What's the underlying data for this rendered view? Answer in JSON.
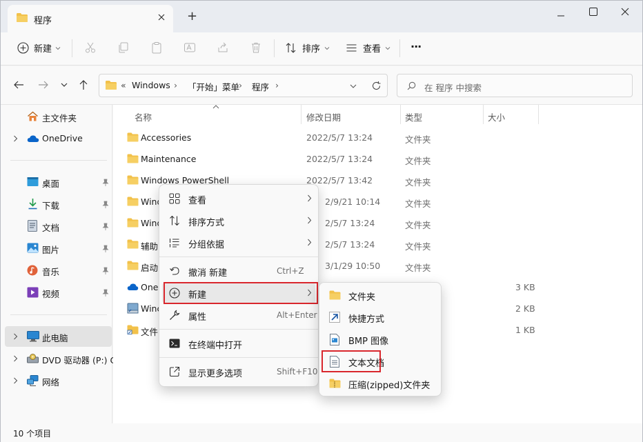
{
  "window": {
    "tab_title": "程序",
    "new_tab": "+"
  },
  "toolbar": {
    "new_label": "新建",
    "sort_label": "排序",
    "view_label": "查看",
    "more_label": "···"
  },
  "address": {
    "overflow": "«",
    "crumbs": [
      "Windows",
      "「开始」菜单",
      "程序"
    ],
    "search_placeholder": "在 程序 中搜索"
  },
  "nav": {
    "home": "主文件夹",
    "onedrive": "OneDrive",
    "desktop": "桌面",
    "downloads": "下载",
    "documents": "文档",
    "pictures": "图片",
    "music": "音乐",
    "videos": "视频",
    "this_pc": "此电脑",
    "dvd": "DVD 驱动器 (P:) C",
    "network": "网络"
  },
  "columns": {
    "name": "名称",
    "date": "修改日期",
    "type": "类型",
    "size": "大小"
  },
  "files": [
    {
      "name": "Accessories",
      "date": "2022/5/7 13:24",
      "type": "文件夹",
      "size": ""
    },
    {
      "name": "Maintenance",
      "date": "2022/5/7 13:24",
      "type": "文件夹",
      "size": ""
    },
    {
      "name": "Windows PowerShell",
      "date": "2022/5/7 13:42",
      "type": "文件夹",
      "size": ""
    },
    {
      "name": "Wind",
      "date": "2/9/21 10:14",
      "type": "文件夹",
      "size": ""
    },
    {
      "name": "Wind",
      "date": "2/5/7 13:24",
      "type": "文件夹",
      "size": ""
    },
    {
      "name": "辅助",
      "date": "2/5/7 13:24",
      "type": "文件夹",
      "size": ""
    },
    {
      "name": "启动",
      "date": "3/1/29 10:50",
      "type": "文件夹",
      "size": ""
    },
    {
      "name": "OneI",
      "date": "",
      "type": "",
      "size": "3 KB"
    },
    {
      "name": "Winc",
      "date": "",
      "type": "",
      "size": "2 KB"
    },
    {
      "name": "文件",
      "date": "",
      "type": "",
      "size": "1 KB"
    }
  ],
  "context_menu": {
    "view": "查看",
    "sort": "排序方式",
    "group": "分组依据",
    "undo": "撤消 新建",
    "undo_sc": "Ctrl+Z",
    "new": "新建",
    "props": "属性",
    "props_sc": "Alt+Enter",
    "terminal": "在终端中打开",
    "more": "显示更多选项",
    "more_sc": "Shift+F10"
  },
  "submenu": {
    "folder": "文件夹",
    "shortcut": "快捷方式",
    "bmp": "BMP 图像",
    "text": "文本文档",
    "zip": "压缩(zipped)文件夹"
  },
  "status": {
    "count": "10 个项目"
  },
  "colors": {
    "folder": "#f2c14a",
    "highlight_border": "#d9262c",
    "accent": "#0067c0"
  }
}
